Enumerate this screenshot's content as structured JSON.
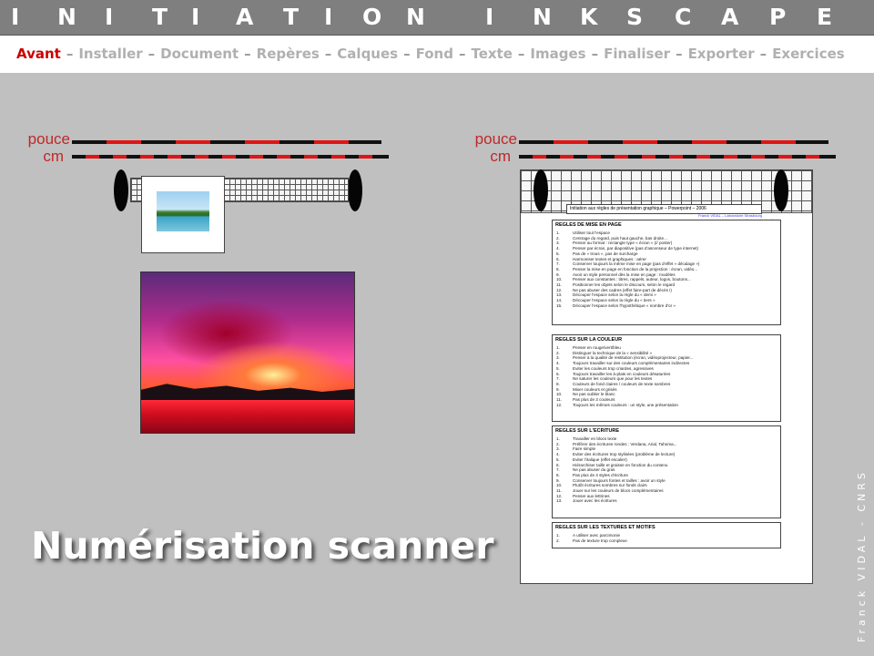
{
  "header": {
    "title": "INITIATION INKSCAPE",
    "letters": [
      "I",
      "N",
      "I",
      "T",
      "I",
      "A",
      "T",
      "I",
      "O",
      "N",
      "I",
      "N",
      "K",
      "S",
      "C",
      "A",
      "P",
      "E"
    ]
  },
  "nav": {
    "items": [
      {
        "label": "Avant",
        "active": true
      },
      {
        "label": "Installer",
        "active": false
      },
      {
        "label": "Document",
        "active": false
      },
      {
        "label": "Repères",
        "active": false
      },
      {
        "label": "Calques",
        "active": false
      },
      {
        "label": "Fond",
        "active": false
      },
      {
        "label": "Texte",
        "active": false
      },
      {
        "label": "Images",
        "active": false
      },
      {
        "label": "Finaliser",
        "active": false
      },
      {
        "label": "Exporter",
        "active": false
      },
      {
        "label": "Exercices",
        "active": false
      }
    ],
    "separator": "–"
  },
  "rulers": {
    "left": {
      "inch_label": "pouce",
      "cm_label": "cm"
    },
    "right": {
      "inch_label": "pouce",
      "cm_label": "cm"
    }
  },
  "slide": {
    "big_title": "Numérisation scanner",
    "author_vertical": "Franck VIDAL - CNRS"
  },
  "document": {
    "header": "Initiation aux règles de présentation graphique – Powerpoint – 2006",
    "link1": "Franck VIDAL – Laboratoire Strasbourg",
    "link2": "www.ibmc.u-strasbg.fr",
    "sections": [
      {
        "title": "REGLES DE MISE EN PAGE",
        "items": [
          "Utiliser tout l'espace",
          "Centrage du regard, puis haut gauche, bas droite...",
          "Penser au format : rectangle type « écran » (// poster)",
          "Penser par écran, par diapositive (pas d'ascenseur de type internet)",
          "Pas de « trous », pas de surcharge",
          "Harmoniser textes et graphiques : aérer",
          "Conserver toujours la même mise en page (pas d'effet « décalage »)",
          "Penser la mise en page en fonction de la projection : écran, vidéo...",
          "Avoir un style personnel dès la mise en page : modèles",
          "Penser aux constantes : titres, rappels, auteur, logos, boutons...",
          "Positionner les objets selon le discours, selon le regard",
          "Ne pas abuser des cadres (effet faire-part de décès !)",
          "Découper l'espace selon la règle du « demi »",
          "Découper l'espace selon la règle du « tiers »",
          "Découper l'espace selon l'hypothétique « nombre d'or »"
        ]
      },
      {
        "title": "REGLES SUR LA COULEUR",
        "items": [
          "Penser en rouge/vert/bleu",
          "Distinguer la technique de la « sensibilité »",
          "Penser à la qualité de restitution (écran, vidéoprojecteur, papier...",
          "Toujours travailler sur des couleurs complémentaires indirectes",
          "Eviter les couleurs trop criardes, agressives",
          "Toujours travailler les à-plats en couleurs désaturées",
          "Ne saturer les couleurs que pour les textes",
          "Couleurs de fond claires / couleurs de texte sombres",
          "Mixer couleurs et grisés",
          "Ne pas oublier le blanc",
          "Pas plus de 3 couleurs",
          "Toujours les mêmes couleurs : un style, une présentation"
        ]
      },
      {
        "title": "REGLES SUR L'ECRITURE",
        "items": [
          "Travailler en blocs texte",
          "Préférer des écritures rondes : Verdana, Arial, Tahoma...",
          "Faire simple",
          "Eviter des écritures trop stylisées (problème de lecture)",
          "Eviter l'italique (effet escalier)",
          "Hiérarchiser taille et graisse en fonction du contenu",
          "Ne pas abuser du gras",
          "Pas plus de 3 styles d'écriture",
          "Conserver toujours fontes et tailles : avoir un style",
          "Plutôt écritures sombres sur fonds clairs",
          "Jouer sur les couleurs de blocs complémentaires",
          "Penser aux lettrines",
          "Jouer avec les écritures"
        ]
      },
      {
        "title": "REGLES SUR LES TEXTURES ET MOTIFS",
        "items": [
          "A utiliser avec parcimonie",
          "Pas de texture trop complexe"
        ]
      }
    ]
  },
  "colors": {
    "accent_red": "#cc0000",
    "ruler_red": "#e01515",
    "header_gray": "#7f7f7f",
    "background_gray": "#c0c0c0"
  }
}
